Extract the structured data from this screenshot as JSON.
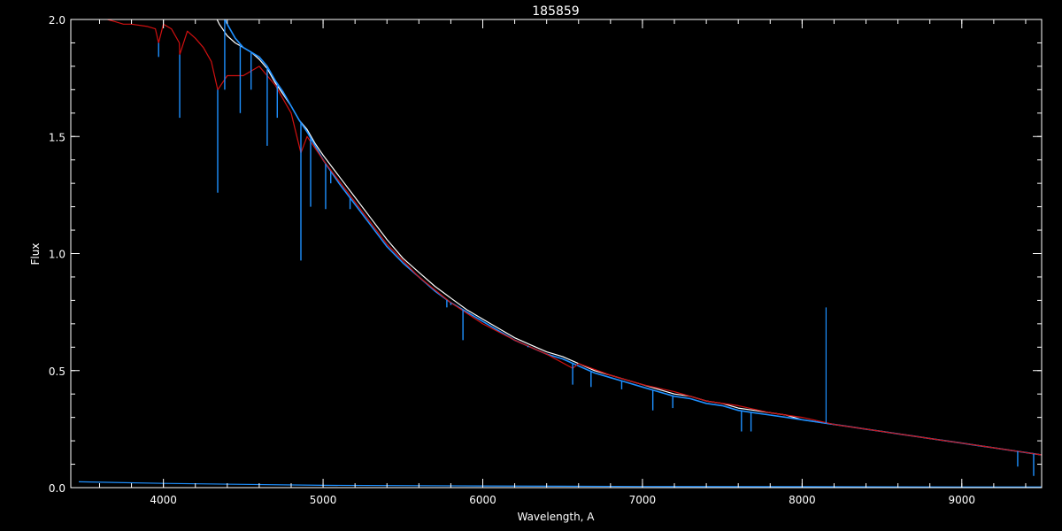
{
  "chart_data": {
    "type": "line",
    "title": "185859",
    "xlabel": "Wavelength, A",
    "ylabel": "Flux",
    "xlim": [
      3420,
      9500
    ],
    "ylim": [
      0.0,
      2.0
    ],
    "x_ticks": [
      {
        "value": 4000,
        "label": "4000"
      },
      {
        "value": 5000,
        "label": "5000"
      },
      {
        "value": 6000,
        "label": "6000"
      },
      {
        "value": 7000,
        "label": "7000"
      },
      {
        "value": 8000,
        "label": "8000"
      },
      {
        "value": 9000,
        "label": "9000"
      }
    ],
    "y_ticks": [
      {
        "value": 0.0,
        "label": "0.0"
      },
      {
        "value": 0.5,
        "label": "0.5"
      },
      {
        "value": 1.0,
        "label": "1.0"
      },
      {
        "value": 1.5,
        "label": "1.5"
      },
      {
        "value": 2.0,
        "label": "2.0"
      }
    ],
    "x_minor_step": 200,
    "y_minor_step": 0.1,
    "colors": {
      "background": "#000000",
      "axes": "#ffffff",
      "observed": "#ffffff",
      "model": "#d01010",
      "corrected": "#1e90ff",
      "error": "#1e90ff"
    },
    "series": [
      {
        "role": "observed",
        "x": [
          3650,
          3800,
          3900,
          4000,
          4100,
          4200,
          4300,
          4350,
          4400,
          4450,
          4500,
          4550,
          4600,
          4650,
          4700,
          4750,
          4800,
          4850,
          4900,
          4950,
          5000,
          5100,
          5200,
          5300,
          5400,
          5500,
          5600,
          5700,
          5800,
          5900,
          6000,
          6100,
          6200,
          6300,
          6400,
          6500,
          6600,
          6700,
          6800,
          6900,
          7000,
          7100,
          7200,
          7300,
          7400,
          7500,
          7600,
          7700,
          7800,
          7900,
          8000,
          8100,
          8200,
          8300,
          8400,
          8500,
          8600,
          8700,
          8800,
          8900,
          9000,
          9100,
          9200,
          9300,
          9400,
          9500
        ],
        "y": [
          2.05,
          2.05,
          2.05,
          2.05,
          2.05,
          2.05,
          2.05,
          1.98,
          1.93,
          1.9,
          1.88,
          1.86,
          1.83,
          1.79,
          1.73,
          1.68,
          1.63,
          1.57,
          1.53,
          1.47,
          1.42,
          1.33,
          1.24,
          1.15,
          1.06,
          0.98,
          0.92,
          0.86,
          0.81,
          0.76,
          0.72,
          0.68,
          0.64,
          0.61,
          0.58,
          0.56,
          0.53,
          0.5,
          0.48,
          0.46,
          0.44,
          0.42,
          0.4,
          0.39,
          0.37,
          0.36,
          0.34,
          0.33,
          0.32,
          0.31,
          0.29,
          0.28,
          0.27,
          0.26,
          0.25,
          0.24,
          0.23,
          0.22,
          0.21,
          0.2,
          0.19,
          0.18,
          0.17,
          0.16,
          0.15,
          0.14
        ]
      },
      {
        "role": "model",
        "x": [
          3650,
          3700,
          3750,
          3800,
          3900,
          3950,
          3970,
          4000,
          4050,
          4100,
          4102,
          4150,
          4200,
          4250,
          4300,
          4340,
          4400,
          4500,
          4600,
          4700,
          4800,
          4861,
          4900,
          5000,
          5200,
          5400,
          5600,
          5800,
          6000,
          6200,
          6400,
          6563,
          6600,
          6800,
          7000,
          7200,
          7400,
          7600,
          7800,
          8000,
          8200,
          8400,
          8600,
          8800,
          9000,
          9200,
          9400,
          9500
        ],
        "y": [
          2.0,
          1.99,
          1.98,
          1.98,
          1.97,
          1.96,
          1.9,
          1.98,
          1.96,
          1.9,
          1.85,
          1.95,
          1.92,
          1.88,
          1.82,
          1.7,
          1.76,
          1.76,
          1.8,
          1.72,
          1.6,
          1.43,
          1.5,
          1.4,
          1.22,
          1.04,
          0.9,
          0.79,
          0.7,
          0.63,
          0.57,
          0.51,
          0.53,
          0.48,
          0.44,
          0.41,
          0.37,
          0.35,
          0.32,
          0.3,
          0.27,
          0.25,
          0.23,
          0.21,
          0.19,
          0.17,
          0.15,
          0.14
        ]
      },
      {
        "role": "corrected",
        "x": [
          4350,
          4400,
          4450,
          4500,
          4550,
          4600,
          4650,
          4700,
          4750,
          4800,
          4850,
          4900,
          4950,
          5000,
          5100,
          5200,
          5300,
          5400,
          5500,
          5600,
          5700,
          5800,
          5900,
          6000,
          6100,
          6200,
          6300,
          6400,
          6500,
          6600,
          6700,
          6800,
          6900,
          7000,
          7100,
          7200,
          7300,
          7400,
          7500,
          7600,
          7700,
          7800,
          7900,
          8000,
          8100,
          8200,
          8300,
          8400,
          8500,
          8600,
          8700,
          8800,
          8900,
          9000,
          9100,
          9200,
          9300,
          9400,
          9500
        ],
        "y": [
          2.05,
          1.98,
          1.92,
          1.88,
          1.86,
          1.84,
          1.8,
          1.74,
          1.69,
          1.63,
          1.57,
          1.52,
          1.46,
          1.4,
          1.3,
          1.21,
          1.12,
          1.03,
          0.96,
          0.9,
          0.84,
          0.79,
          0.75,
          0.71,
          0.67,
          0.63,
          0.6,
          0.57,
          0.55,
          0.52,
          0.49,
          0.47,
          0.45,
          0.43,
          0.41,
          0.39,
          0.38,
          0.36,
          0.35,
          0.33,
          0.32,
          0.31,
          0.3,
          0.29,
          0.28,
          0.27,
          0.26,
          0.25,
          0.24,
          0.23,
          0.22,
          0.21,
          0.2,
          0.19,
          0.18,
          0.17,
          0.16,
          0.15,
          0.14
        ]
      },
      {
        "role": "error",
        "x": [
          3470,
          4000,
          5000,
          6000,
          7000,
          8000,
          9000,
          9500
        ],
        "y": [
          0.025,
          0.018,
          0.01,
          0.007,
          0.005,
          0.004,
          0.003,
          0.003
        ]
      }
    ],
    "absorption_lines": [
      {
        "x": 3970,
        "bottom": 1.84
      },
      {
        "x": 4102,
        "bottom": 1.58
      },
      {
        "x": 4340,
        "bottom": 1.26
      },
      {
        "x": 4384,
        "bottom": 1.7
      },
      {
        "x": 4481,
        "bottom": 1.6
      },
      {
        "x": 4549,
        "bottom": 1.7
      },
      {
        "x": 4650,
        "bottom": 1.46
      },
      {
        "x": 4713,
        "bottom": 1.58
      },
      {
        "x": 4861,
        "bottom": 0.97
      },
      {
        "x": 4922,
        "bottom": 1.2
      },
      {
        "x": 5016,
        "bottom": 1.19
      },
      {
        "x": 5048,
        "bottom": 1.3
      },
      {
        "x": 5169,
        "bottom": 1.19
      },
      {
        "x": 5775,
        "bottom": 0.77
      },
      {
        "x": 5800,
        "bottom": 0.78
      },
      {
        "x": 5876,
        "bottom": 0.63
      },
      {
        "x": 6283,
        "bottom": 0.6
      },
      {
        "x": 6563,
        "bottom": 0.44
      },
      {
        "x": 6678,
        "bottom": 0.43
      },
      {
        "x": 6870,
        "bottom": 0.42
      },
      {
        "x": 7065,
        "bottom": 0.33
      },
      {
        "x": 7190,
        "bottom": 0.34
      },
      {
        "x": 7620,
        "bottom": 0.24
      },
      {
        "x": 7680,
        "bottom": 0.24
      },
      {
        "x": 9350,
        "bottom": 0.09
      },
      {
        "x": 9450,
        "bottom": 0.05
      }
    ],
    "spikes": [
      {
        "x": 8150,
        "top": 0.77
      }
    ]
  }
}
